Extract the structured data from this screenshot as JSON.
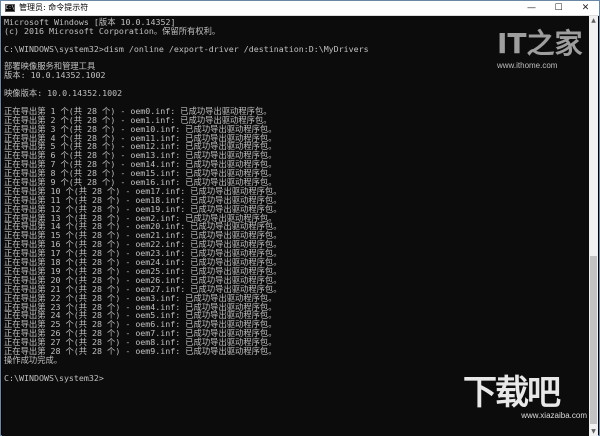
{
  "window": {
    "title": "管理员: 命令提示符",
    "icon_label": "C:\\",
    "controls": {
      "minimize": "—",
      "maximize": "☐",
      "close": "✕"
    }
  },
  "console": {
    "lines": [
      "Microsoft Windows [版本 10.0.14352]",
      "(c) 2016 Microsoft Corporation。保留所有权利。",
      "",
      "C:\\WINDOWS\\system32>dism /online /export-driver /destination:D:\\MyDrivers",
      "",
      "部署映像服务和管理工具",
      "版本: 10.0.14352.1002",
      "",
      "映像版本: 10.0.14352.1002",
      "",
      "正在导出第 1 个(共 28 个) - oem0.inf: 已成功导出驱动程序包。",
      "正在导出第 2 个(共 28 个) - oem1.inf: 已成功导出驱动程序包。",
      "正在导出第 3 个(共 28 个) - oem10.inf: 已成功导出驱动程序包。",
      "正在导出第 4 个(共 28 个) - oem11.inf: 已成功导出驱动程序包。",
      "正在导出第 5 个(共 28 个) - oem12.inf: 已成功导出驱动程序包。",
      "正在导出第 6 个(共 28 个) - oem13.inf: 已成功导出驱动程序包。",
      "正在导出第 7 个(共 28 个) - oem14.inf: 已成功导出驱动程序包。",
      "正在导出第 8 个(共 28 个) - oem15.inf: 已成功导出驱动程序包。",
      "正在导出第 9 个(共 28 个) - oem16.inf: 已成功导出驱动程序包。",
      "正在导出第 10 个(共 28 个) - oem17.inf: 已成功导出驱动程序包。",
      "正在导出第 11 个(共 28 个) - oem18.inf: 已成功导出驱动程序包。",
      "正在导出第 12 个(共 28 个) - oem19.inf: 已成功导出驱动程序包。",
      "正在导出第 13 个(共 28 个) - oem2.inf: 已成功导出驱动程序包。",
      "正在导出第 14 个(共 28 个) - oem20.inf: 已成功导出驱动程序包。",
      "正在导出第 15 个(共 28 个) - oem21.inf: 已成功导出驱动程序包。",
      "正在导出第 16 个(共 28 个) - oem22.inf: 已成功导出驱动程序包。",
      "正在导出第 17 个(共 28 个) - oem23.inf: 已成功导出驱动程序包。",
      "正在导出第 18 个(共 28 个) - oem24.inf: 已成功导出驱动程序包。",
      "正在导出第 19 个(共 28 个) - oem25.inf: 已成功导出驱动程序包。",
      "正在导出第 20 个(共 28 个) - oem26.inf: 已成功导出驱动程序包。",
      "正在导出第 21 个(共 28 个) - oem27.inf: 已成功导出驱动程序包。",
      "正在导出第 22 个(共 28 个) - oem3.inf: 已成功导出驱动程序包。",
      "正在导出第 23 个(共 28 个) - oem4.inf: 已成功导出驱动程序包。",
      "正在导出第 24 个(共 28 个) - oem5.inf: 已成功导出驱动程序包。",
      "正在导出第 25 个(共 28 个) - oem6.inf: 已成功导出驱动程序包。",
      "正在导出第 26 个(共 28 个) - oem7.inf: 已成功导出驱动程序包。",
      "正在导出第 27 个(共 28 个) - oem8.inf: 已成功导出驱动程序包。",
      "正在导出第 28 个(共 28 个) - oem9.inf: 已成功导出驱动程序包。",
      "操作成功完成。",
      "",
      "C:\\WINDOWS\\system32>"
    ]
  },
  "watermarks": {
    "ithome_logo": "IT之家",
    "ithome_url": "www.ithome.com",
    "xz_logo": "下载吧",
    "xz_url": "www.xiazaiba.com"
  },
  "colors": {
    "console_bg": "#0c0c0c",
    "console_text": "#c0c0c0",
    "titlebar_bg": "#ffffff"
  }
}
